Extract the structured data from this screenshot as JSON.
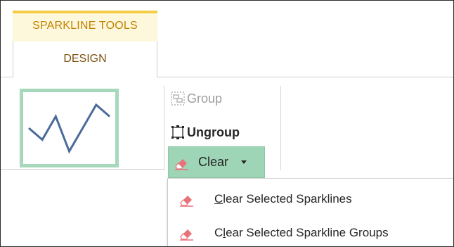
{
  "ribbon": {
    "contextual_tab_title": "SPARKLINE TOOLS",
    "active_tab": "DESIGN"
  },
  "sparkline_preview": {
    "values": [
      2,
      1,
      3,
      0,
      2,
      4,
      3
    ]
  },
  "group": {
    "group_label": "Group",
    "ungroup_label": "Ungroup",
    "clear_label": "Clear",
    "group_enabled": false
  },
  "clear_menu": {
    "items": [
      {
        "underlined_letter": "C",
        "rest": "lear Selected Sparklines",
        "icon": "eraser-icon"
      },
      {
        "prefix": "C",
        "underlined_letter": "l",
        "rest": "ear Selected Sparkline Groups",
        "icon": "eraser-icon"
      }
    ]
  },
  "colors": {
    "accent_green": "#9fd5b7",
    "sparkline_line": "#4a6b9a",
    "contextual_gold": "#f2cd45",
    "eraser_pink": "#e8727a"
  }
}
